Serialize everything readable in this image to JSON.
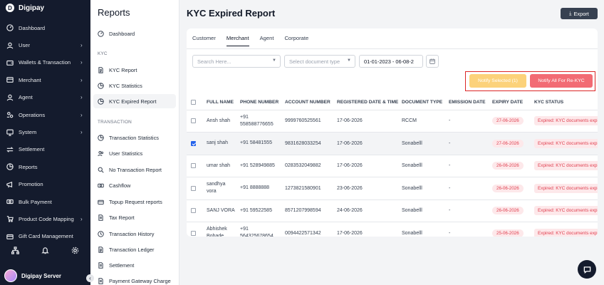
{
  "brand": {
    "name": "Digipay",
    "logo_letter": "D"
  },
  "nav": {
    "items": [
      {
        "label": "Dashboard",
        "icon": "dashboard-icon",
        "chevron": ""
      },
      {
        "label": "User",
        "icon": "user-icon",
        "chevron": "›"
      },
      {
        "label": "Wallets & Transaction",
        "icon": "wallet-icon",
        "chevron": "›"
      },
      {
        "label": "Merchant",
        "icon": "store-icon",
        "chevron": "›"
      },
      {
        "label": "Agent",
        "icon": "agent-icon",
        "chevron": "›"
      },
      {
        "label": "Operations",
        "icon": "operations-icon",
        "chevron": "›"
      },
      {
        "label": "System",
        "icon": "monitor-icon",
        "chevron": "›"
      },
      {
        "label": "Settlement",
        "icon": "transfer-icon",
        "chevron": ""
      },
      {
        "label": "Reports",
        "icon": "reports-icon",
        "chevron": ""
      },
      {
        "label": "Promotion",
        "icon": "promotion-icon",
        "chevron": ""
      },
      {
        "label": "Bulk Payment",
        "icon": "bulk-payment-icon",
        "chevron": ""
      },
      {
        "label": "Product Code Mapping",
        "icon": "cart-icon",
        "chevron": "›"
      },
      {
        "label": "Gift Card Management",
        "icon": "gift-card-icon",
        "chevron": ""
      }
    ],
    "profile_name": "Digipay Server",
    "collapse_glyph": "‹"
  },
  "sub": {
    "title": "Reports",
    "dashboard_label": "Dashboard",
    "kyc_section": "KYC",
    "kyc_items": [
      "KYC Report",
      "KYC Statistics",
      "KYC Expired Report"
    ],
    "transaction_section": "TRANSACTION",
    "transaction_items": [
      "Transaction Statistics",
      "User Statistics",
      "No Transaction Report",
      "Cashflow",
      "Topup Request reports",
      "Tax Report",
      "Transaction History",
      "Transaction Ledger",
      "Settlement",
      "Payment Gateway Charge"
    ]
  },
  "main": {
    "title": "KYC Expired Report",
    "export_label": "Export",
    "tabs": [
      "Customer",
      "Merchant",
      "Agent",
      "Corporate"
    ],
    "active_tab": 1,
    "search_placeholder": "Search Here...",
    "doc_type_placeholder": "Select document type",
    "date_range": "01-01-2023 - 06-08-2",
    "notify_selected_label": "Notify Selected (1)",
    "notify_all_label": "Notify All For Re-KYC"
  },
  "table": {
    "headers": [
      "FULL NAME",
      "PHONE NUMBER",
      "ACCOUNT NUMBER",
      "REGISTERED DATE & TIME",
      "DOCUMENT TYPE",
      "EMISSION DATE",
      "EXPIRY DATE",
      "KYC STATUS"
    ],
    "rows": [
      {
        "name": "Ansh shah",
        "phone": "+91 558588776655",
        "account": "9999760525561",
        "registered": "17-06-2026",
        "doc": "RCCM",
        "emission": "-",
        "expiry": "27-06-2026",
        "status": "Expired: KYC documents expi",
        "checked": false
      },
      {
        "name": "sanj shah",
        "phone": "+91 58481555",
        "account": "9831628033254",
        "registered": "17-06-2026",
        "doc": "Sonabelll",
        "emission": "-",
        "expiry": "27-06-2026",
        "status": "Expired: KYC documents expi",
        "checked": true
      },
      {
        "name": "umar shah",
        "phone": "+91 528949885",
        "account": "0283532049882",
        "registered": "17-06-2026",
        "doc": "Sonabelll",
        "emission": "-",
        "expiry": "26-06-2026",
        "status": "Expired: KYC documents expi",
        "checked": false
      },
      {
        "name": "sandhya vora",
        "phone": "+91 8888888",
        "account": "1273821580901",
        "registered": "23-06-2026",
        "doc": "Sonabelll",
        "emission": "-",
        "expiry": "26-06-2026",
        "status": "Expired: KYC documents expi",
        "checked": false
      },
      {
        "name": "SANJ VORA",
        "phone": "+91 59522585",
        "account": "8571207998594",
        "registered": "24-06-2026",
        "doc": "Sonabelll",
        "emission": "-",
        "expiry": "26-06-2026",
        "status": "Expired: KYC documents expi",
        "checked": false
      },
      {
        "name": "Abhishek Bobade",
        "phone": "+91 564325678654",
        "account": "0094422571342",
        "registered": "17-06-2026",
        "doc": "Sonabelll",
        "emission": "-",
        "expiry": "25-06-2026",
        "status": "Expired: KYC documents expi",
        "checked": false
      }
    ]
  }
}
